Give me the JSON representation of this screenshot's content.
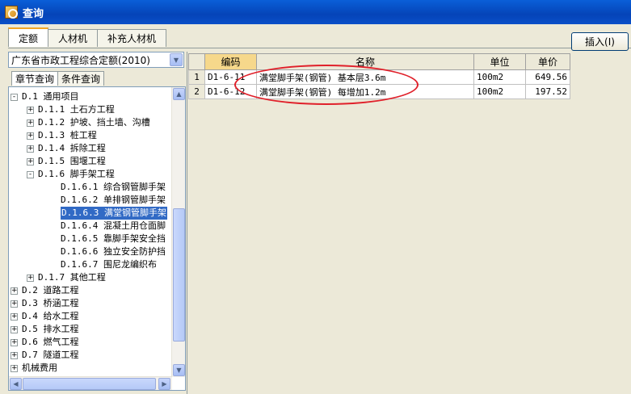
{
  "window": {
    "title": "查询"
  },
  "tabs": [
    "定额",
    "人材机",
    "补充人材机"
  ],
  "insert_button": "插入(I)",
  "combo": {
    "value": "广东省市政工程综合定额(2010)"
  },
  "subtabs": [
    "章节查询",
    "条件查询"
  ],
  "tree": [
    {
      "level": 0,
      "exp": "-",
      "label": "D.1 通用项目"
    },
    {
      "level": 1,
      "exp": "+",
      "label": "D.1.1 土石方工程"
    },
    {
      "level": 1,
      "exp": "+",
      "label": "D.1.2 护坡、挡土墙、沟槽"
    },
    {
      "level": 1,
      "exp": "+",
      "label": "D.1.3 桩工程"
    },
    {
      "level": 1,
      "exp": "+",
      "label": "D.1.4  拆除工程"
    },
    {
      "level": 1,
      "exp": "+",
      "label": "D.1.5 围堰工程"
    },
    {
      "level": 1,
      "exp": "-",
      "label": "D.1.6 脚手架工程"
    },
    {
      "level": 2,
      "exp": "",
      "label": "D.1.6.1 综合钢管脚手架"
    },
    {
      "level": 2,
      "exp": "",
      "label": "D.1.6.2 单排钢管脚手架"
    },
    {
      "level": 2,
      "exp": "",
      "label": "D.1.6.3 满堂钢管脚手架",
      "selected": true
    },
    {
      "level": 2,
      "exp": "",
      "label": "D.1.6.4 混凝土用仓面脚"
    },
    {
      "level": 2,
      "exp": "",
      "label": "D.1.6.5 靠脚手架安全挡"
    },
    {
      "level": 2,
      "exp": "",
      "label": "D.1.6.6 独立安全防护挡"
    },
    {
      "level": 2,
      "exp": "",
      "label": "D.1.6.7 围尼龙编织布"
    },
    {
      "level": 1,
      "exp": "+",
      "label": "D.1.7 其他工程"
    },
    {
      "level": 0,
      "exp": "+",
      "label": "D.2 道路工程"
    },
    {
      "level": 0,
      "exp": "+",
      "label": "D.3 桥涵工程"
    },
    {
      "level": 0,
      "exp": "+",
      "label": "D.4 给水工程"
    },
    {
      "level": 0,
      "exp": "+",
      "label": "D.5 排水工程"
    },
    {
      "level": 0,
      "exp": "+",
      "label": "D.6 燃气工程"
    },
    {
      "level": 0,
      "exp": "+",
      "label": "D.7 隧道工程"
    },
    {
      "level": 0,
      "exp": "+",
      "label": "机械费用"
    }
  ],
  "grid": {
    "headers": [
      "",
      "编码",
      "名称",
      "单位",
      "单价"
    ],
    "rows": [
      [
        "1",
        "D1-6-11",
        "满堂脚手架(钢管) 基本层3.6m",
        "100m2",
        "649.56"
      ],
      [
        "2",
        "D1-6-12",
        "满堂脚手架(钢管) 每增加1.2m",
        "100m2",
        "197.52"
      ]
    ]
  }
}
